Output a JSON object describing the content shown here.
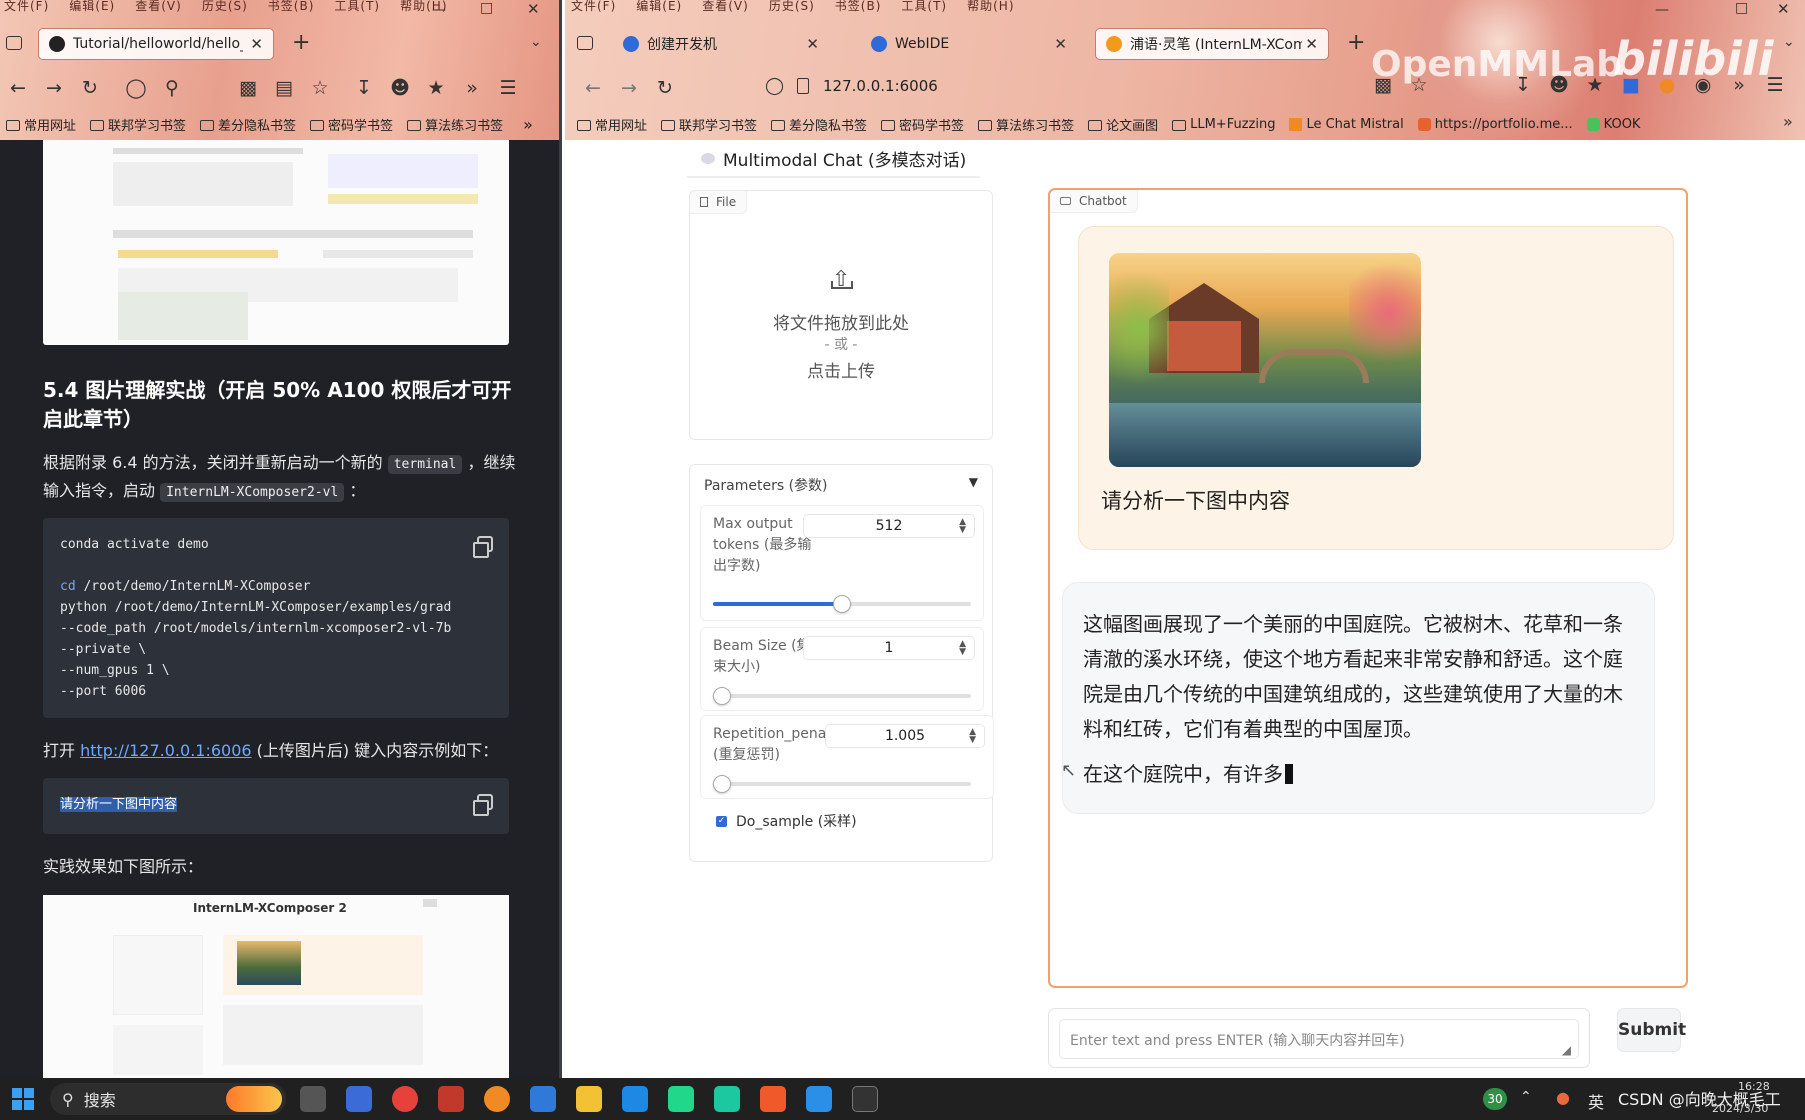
{
  "left_window": {
    "menu": [
      "文件(F)",
      "编辑(E)",
      "查看(V)",
      "历史(S)",
      "书签(B)",
      "工具(T)",
      "帮助(H)"
    ],
    "tab_title": "Tutorial/helloworld/hello_w",
    "bookmarks": [
      "常用网址",
      "联邦学习书签",
      "差分隐私书签",
      "密码学书签",
      "算法练习书签"
    ],
    "doc": {
      "heading": "5.4 图片理解实战（开启 50% A100 权限后才可开启此章节）",
      "para1_a": "根据附录 6.4 的方法，关闭并重新启动一个新的",
      "para1_code1": "terminal",
      "para1_b": "，继续输入指令，启动",
      "para1_code2": "InternLM-XComposer2-vl",
      "para1_c": "：",
      "code_lines": [
        {
          "kw": "",
          "text": "conda activate demo"
        },
        {
          "kw": "",
          "text": ""
        },
        {
          "kw": "cd",
          "text": " /root/demo/InternLM-XComposer"
        },
        {
          "kw": "",
          "text": "python /root/demo/InternLM-XComposer/examples/grad"
        },
        {
          "kw": "",
          "text": "--code_path /root/models/internlm-xcomposer2-vl-7b"
        },
        {
          "kw": "",
          "text": "--private \\"
        },
        {
          "kw": "",
          "text": "--num_gpus 1 \\"
        },
        {
          "kw": "",
          "text": "--port 6006"
        }
      ],
      "para2_a": "打开",
      "para2_link": "http://127.0.0.1:6006",
      "para2_b": "(上传图片后) 键入内容示例如下：",
      "prompt_code": "请分析一下图中内容",
      "para3": "实践效果如下图所示：",
      "thumb_title": "InternLM-XComposer 2"
    }
  },
  "right_window": {
    "menu": [
      "文件(F)",
      "编辑(E)",
      "查看(V)",
      "历史(S)",
      "书签(B)",
      "工具(T)",
      "帮助(H)"
    ],
    "tabs": [
      {
        "title": "创建开发机",
        "active": false
      },
      {
        "title": "WebIDE",
        "active": false
      },
      {
        "title": "浦语·灵笔 (InternLM-XComp",
        "active": true
      }
    ],
    "url": "127.0.0.1:6006",
    "watermark": "OpenMMLab",
    "watermark2": "bilibili",
    "bookmarks": [
      "常用网址",
      "联邦学习书签",
      "差分隐私书签",
      "密码学书签",
      "算法练习书签",
      "论文画图",
      "LLM+Fuzzing",
      "Le Chat Mistral",
      "https://portfolio.me...",
      "KOOK"
    ],
    "app": {
      "tab_label": "Multimodal Chat (多模态对话)",
      "file_label": "File",
      "upload_line1": "将文件拖放到此处",
      "upload_line2": "- 或 -",
      "upload_line3": "点击上传",
      "params_label": "Parameters (参数)",
      "max_tokens_label": "Max output tokens (最多输出字数)",
      "max_tokens_value": "512",
      "max_tokens_slider_fraction": 0.5,
      "beam_label": "Beam Size (集束大小)",
      "beam_value": "1",
      "beam_slider_fraction": 0.0,
      "rep_label": "Repetition_penalty (重复惩罚)",
      "rep_value": "1.005",
      "rep_slider_fraction": 0.0,
      "do_sample_label": "Do_sample (采样)",
      "do_sample_checked": true,
      "chatbot_label": "Chatbot",
      "user_message": "请分析一下图中内容",
      "bot_para1": "这幅图画展现了一个美丽的中国庭院。它被树木、花草和一条清澈的溪水环绕，使这个地方看起来非常安静和舒适。这个庭院是由几个传统的中国建筑组成的，这些建筑使用了大量的木料和红砖，它们有着典型的中国屋顶。",
      "bot_para2": "在这个庭院中，有许多",
      "input_placeholder": "Enter text and press ENTER (输入聊天内容并回车)",
      "submit_label": "Submit"
    }
  },
  "taskbar": {
    "search_label": "搜索",
    "badge": "30",
    "ime": "英",
    "overlay_text": "CSDN @向晚大概毛工",
    "time": "16:28",
    "date": "2024/3/30"
  },
  "colors": {
    "accent_orange": "#f2a16c",
    "slider_blue": "#2f6ad8",
    "link_blue": "#6ea8ff",
    "doc_bg": "#1f2126"
  }
}
